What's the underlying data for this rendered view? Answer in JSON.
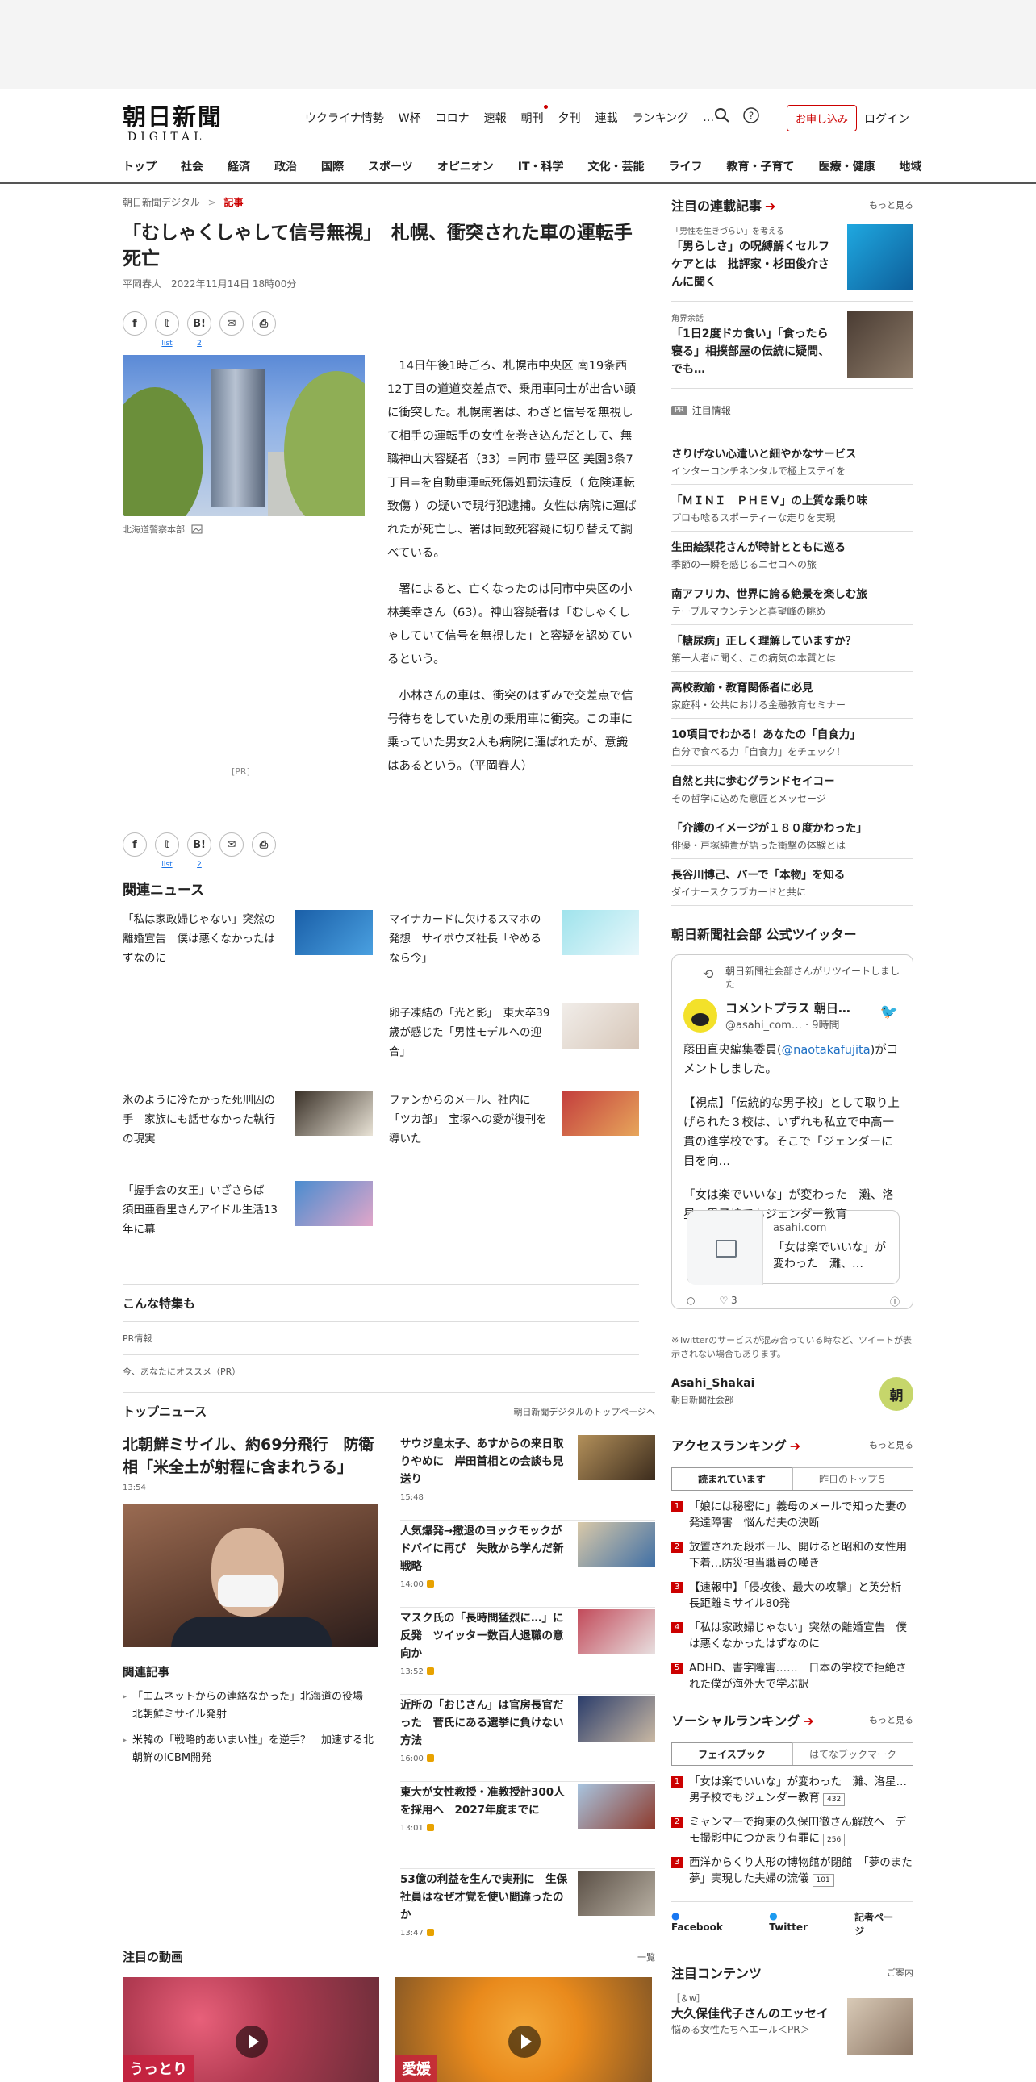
{
  "header": {
    "logo_jp": "朝日新聞",
    "logo_en": "DIGITAL",
    "nav": [
      "ウクライナ情勢",
      "W杯",
      "コロナ",
      "速報",
      "朝刊",
      "夕刊",
      "連載",
      "ランキング",
      "…"
    ],
    "subscribe": "お申し込み",
    "login": "ログイン"
  },
  "categories": [
    "トップ",
    "社会",
    "経済",
    "政治",
    "国際",
    "スポーツ",
    "オピニオン",
    "IT・科学",
    "文化・芸能",
    "ライフ",
    "教育・子育て",
    "医療・健康",
    "地域"
  ],
  "article": {
    "breadcrumb_site": "朝日新聞デジタル",
    "breadcrumb_sep": ">",
    "breadcrumb_current": "記事",
    "title": "「むしゃくしゃして信号無視」　札幌、衝突された車の運転手死亡",
    "byline": "平岡春人　2022年11月14日 18時00分",
    "share": {
      "fb": "f",
      "tw": "𝕥",
      "hb": "B!",
      "mail": "✉",
      "print": "⎙",
      "list": "list",
      "count": "2"
    },
    "photo_caption": "北海道警察本部",
    "pr_label": "[PR]",
    "paragraphs": [
      "14日午後1時ごろ、札幌市中央区 南19条西12丁目の道道交差点で、乗用車同士が出合い頭に衝突した。札幌南署は、わざと信号を無視して相手の運転手の女性を巻き込んだとして、無職神山大容疑者（33）=同市 豊平区 美園3条7丁目=を自動車運転死傷処罰法違反（ 危険運転致傷 ）の疑いで現行犯逮捕。女性は病院に運ばれたが死亡し、署は同致死容疑に切り替えて調べている。",
      "署によると、亡くなったのは同市中央区の小林美幸さん（63）。神山容疑者は「むしゃくしゃしていて信号を無視した」と容疑を認めているという。",
      "小林さんの車は、衝突のはずみで交差点で信号待ちをしていた別の乗用車に衝突。この車に乗っていた男女2人も病院に運ばれたが、意識はあるという。（平岡春人）"
    ]
  },
  "related": {
    "title": "関連ニュース",
    "items": [
      "「私は家政婦じゃない」突然の離婚宣告　僕は悪くなかったはずなのに",
      "マイナカードに欠けるスマホの発想　サイボウズ社長「やめるなら今」",
      "卵子凍結の「光と影」　東大卒39歳が感じた「男性モデルへの迎合」",
      "氷のように冷たかった死刑囚の手　家族にも話せなかった執行の現実",
      "ファンからのメール、社内に「ツカ部」　宝塚への愛が復刊を導いた",
      "「握手会の女王」いざさらば　須田亜香里さんアイドル生活13年に幕"
    ]
  },
  "special": {
    "title": "こんな特集も",
    "row1": "PR情報",
    "row2": "今、あなたにオススメ（PR）"
  },
  "topnews": {
    "title": "トップニュース",
    "more": "朝日新聞デジタルのトップページへ",
    "lead_title": "北朝鮮ミサイル、約69分飛行　防衛相「米全土が射程に含まれうる」",
    "lead_time": "13:54",
    "related_title": "関連記事",
    "related": [
      "「エムネットからの連絡なかった」北海道の役場　北朝鮮ミサイル発射",
      "米韓の「戦略的あいまい性」を逆手？　加速する北朝鮮のICBM開発"
    ],
    "items": [
      {
        "t": "サウジ皇太子、あすからの来日取りやめに　岸田首相との会談も見送り",
        "tm": "15:48",
        "lock": false
      },
      {
        "t": "人気爆発→撤退のヨックモックがドバイに再び　失敗から学んだ新戦略",
        "tm": "14:00",
        "lock": true
      },
      {
        "t": "マスク氏の「長時間猛烈に…」に反発　ツイッター数百人退職の意向か",
        "tm": "13:52",
        "lock": true
      },
      {
        "t": "近所の「おじさん」は官房長官だった　菅氏にある選挙に負けない方法",
        "tm": "16:00",
        "lock": true
      },
      {
        "t": "東大が女性教授・准教授計300人を採用へ　2027年度までに",
        "tm": "13:01",
        "lock": true
      },
      {
        "t": "53億の利益を生んで実刑に　生保社員はなぜ才覚を使い間違ったのか",
        "tm": "13:47",
        "lock": true
      }
    ]
  },
  "videos": {
    "title": "注目の動画",
    "more": "一覧",
    "labels": [
      "うっとり",
      "愛媛"
    ]
  },
  "side": {
    "serial_title": "注目の連載記事",
    "more": "もっと見る",
    "serial_items": [
      {
        "cat": "「男性を生きづらい」を考える",
        "t": "「男らしさ」の呪縛解くセルフケアとは　批評家・杉田俊介さんに聞く"
      },
      {
        "cat": "角界余話",
        "t": "「1日2度ドカ食い」「食ったら寝る」相撲部屋の伝統に疑問、でも…"
      }
    ],
    "pr_badge": "PR",
    "pr_title": "注目情報",
    "pr_items": [
      {
        "a": "さりげない心遣いと細やかなサービス",
        "b": "インターコンチネンタルで極上ステイを"
      },
      {
        "a": "「ＭＩＮＩ　ＰＨＥＶ」の上質な乗り味",
        "b": "プロも唸るスポーティーな走りを実現"
      },
      {
        "a": "生田絵梨花さんが時計とともに巡る",
        "b": "季節の一瞬を感じるニセコへの旅"
      },
      {
        "a": "南アフリカ、世界に誇る絶景を楽しむ旅",
        "b": "テーブルマウンテンと喜望峰の眺め"
      },
      {
        "a": "「糖尿病」正しく理解していますか？",
        "b": "第一人者に聞く、この病気の本質とは"
      },
      {
        "a": "高校教諭・教育関係者に必見",
        "b": "家庭科・公共における金融教育セミナー"
      },
      {
        "a": "10項目でわかる！あなたの「自食力」",
        "b": "自分で食べる力「自食力」をチェック！"
      },
      {
        "a": "自然と共に歩むグランドセイコー",
        "b": "その哲学に込めた意匠とメッセージ"
      },
      {
        "a": "「介護のイメージが１８０度かわった」",
        "b": "俳優・戸塚純貴が語った衝撃の体験とは"
      },
      {
        "a": "長谷川博己、バーで「本物」を知る",
        "b": "ダイナースクラブカードと共に"
      }
    ],
    "twitter_title": "朝日新聞社会部 公式ツイッター",
    "tw_rt": "朝日新聞社会部さんがリツイートしました",
    "tw_name": "コメントプラス 朝日…",
    "tw_handle": "@asahi_com… · 9時間",
    "tw_text1a": "藤田直央編集委員(",
    "tw_text1link": "@naotakafujita",
    "tw_text1b": ")がコメントしました。",
    "tw_text2": "【視点】「伝統的な男子校」として取り上げられた３校は、いずれも私立で中高一貫の進学校です。そこで「ジェンダーに目を向…",
    "tw_text3": "「女は楽でいいな」が変わった　灘、洛星…男子校でもジェンダー教育",
    "tw_card_domain": "asahi.com",
    "tw_card_text": "「女は楽でいいな」が変わった　灘、…",
    "tw_reply": "○",
    "tw_likes": "♡  3",
    "tw_info": "ⓘ",
    "tw_note": "※Twitterのサービスが混み合っている時など、ツイートが表示されない場合もあります。",
    "tw_acc_name": "Asahi_Shakai",
    "tw_acc_sub": "朝日新聞社会部",
    "tw_acc_circle": "朝",
    "access_title": "アクセスランキング",
    "access_tabs": [
      "読まれています",
      "昨日のトップ５"
    ],
    "access_items": [
      "「娘には秘密に」義母のメールで知った妻の発達障害　悩んだ夫の決断",
      "放置された段ボール、開けると昭和の女性用下着…防災担当職員の嘆き",
      "【速報中】「侵攻後、最大の攻撃」と英分析　長距離ミサイル80発",
      "「私は家政婦じゃない」突然の離婚宣告　僕は悪くなかったはずなのに",
      "ADHD、書字障害……　日本の学校で拒絶された僕が海外大で学ぶ訳"
    ],
    "social_title": "ソーシャルランキング",
    "social_tabs": [
      "フェイスブック",
      "はてなブックマーク"
    ],
    "social_items": [
      {
        "t": "「女は楽でいいな」が変わった　灘、洛星…男子校でもジェンダー教育",
        "c": "432"
      },
      {
        "t": "ミャンマーで拘束の久保田徹さん解放へ　デモ撮影中につかまり有罪に",
        "c": "256"
      },
      {
        "t": "西洋からくり人形の博物館が閉館　「夢のまた夢」実現した夫婦の流儀",
        "c": "101"
      }
    ],
    "soc_links": [
      "Facebook",
      "Twitter",
      "記者ページ"
    ],
    "attention_title": "注目コンテンツ",
    "attention_more": "ご案内",
    "attention_cat": "［＆w］",
    "attention_t": "大久保佳代子さんのエッセイ",
    "attention_sub": "悩める女性たちへエール＜PR＞"
  }
}
